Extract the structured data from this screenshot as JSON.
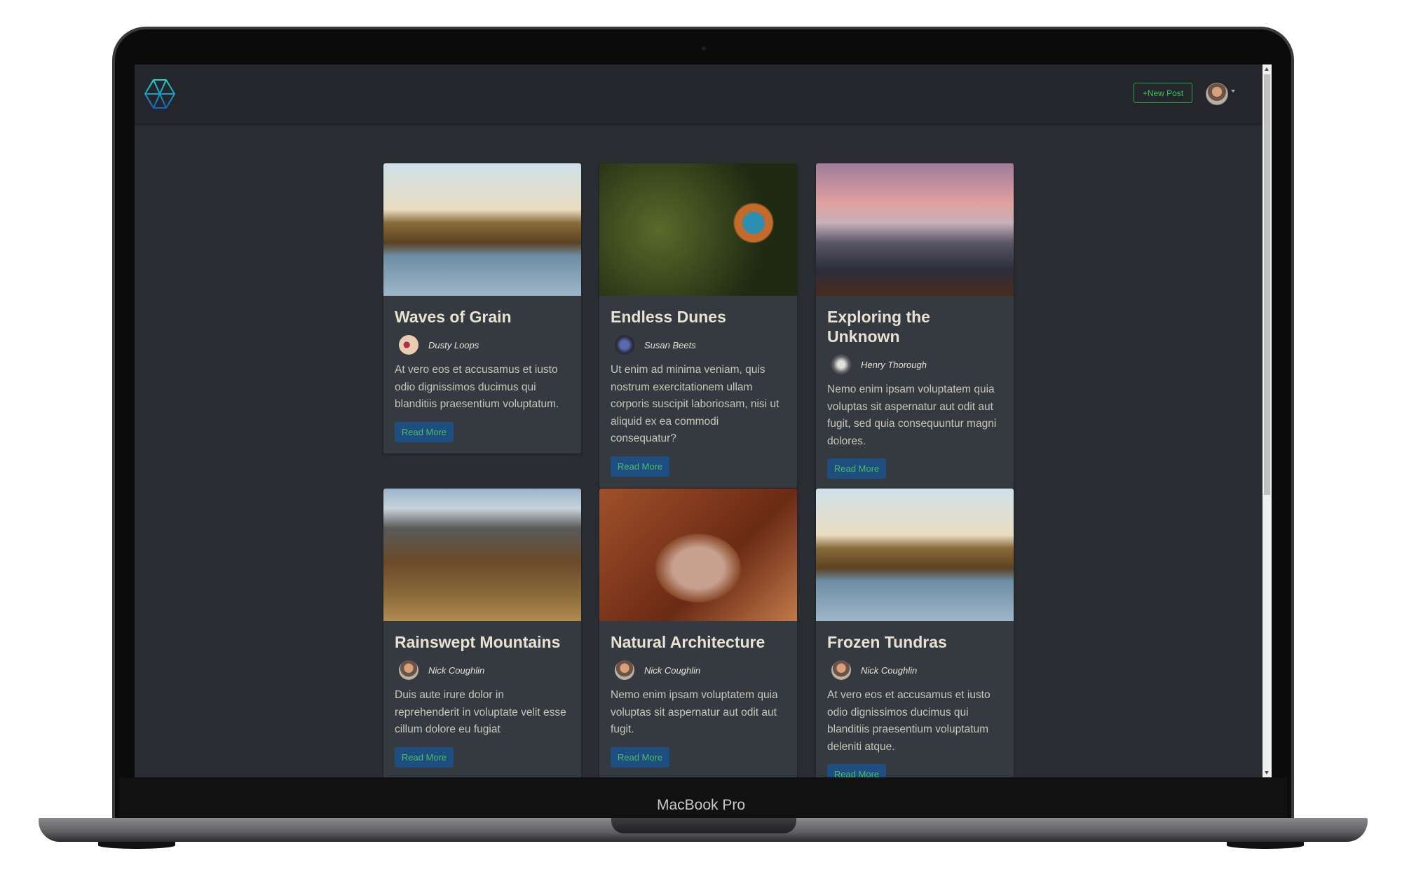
{
  "device": {
    "label": "MacBook Pro"
  },
  "navbar": {
    "logo_icon": "geodesic-hexagon-logo",
    "new_post_label": "+New Post",
    "user_menu_icon": "user-avatar",
    "caret_icon": "caret-down-icon"
  },
  "colors": {
    "accent_green": "#28a745",
    "button_blue": "#1e4d80",
    "card_bg": "#343a40",
    "page_bg": "#2a2e33"
  },
  "posts": [
    {
      "title": "Waves of Grain",
      "author": "Dusty Loops",
      "excerpt": "At vero eos et accusamus et iusto odio dignissimos ducimus qui blanditiis praesentium voluptatum.",
      "button": "Read More",
      "image": "volcano-landscape"
    },
    {
      "title": "Endless Dunes",
      "author": "Susan Beets",
      "excerpt": "Ut enim ad minima veniam, quis nostrum exercitationem ullam corporis suscipit laboriosam, nisi ut aliquid ex ea commodi consequatur?",
      "button": "Read More",
      "image": "kingfisher-bird"
    },
    {
      "title": "Exploring the Unknown",
      "author": "Henry Thorough",
      "excerpt": "Nemo enim ipsam voluptatem quia voluptas sit aspernatur aut odit aut fugit, sed quia consequuntur magni dolores.",
      "button": "Read More",
      "image": "pink-sky-mountains"
    },
    {
      "title": "Rainswept Mountains",
      "author": "Nick Coughlin",
      "excerpt": "Duis aute irure dolor in reprehenderit in voluptate velit esse cillum dolore eu fugiat",
      "button": "Read More",
      "image": "rugged-mountains"
    },
    {
      "title": "Natural Architecture",
      "author": "Nick Coughlin",
      "excerpt": "Nemo enim ipsam voluptatem quia voluptas sit aspernatur aut odit aut fugit.",
      "button": "Read More",
      "image": "rock-arch-canyon"
    },
    {
      "title": "Frozen Tundras",
      "author": "Nick Coughlin",
      "excerpt": "At vero eos et accusamus et iusto odio dignissimos ducimus qui blanditiis praesentium voluptatum deleniti atque.",
      "button": "Read More",
      "image": "volcano-landscape"
    }
  ]
}
